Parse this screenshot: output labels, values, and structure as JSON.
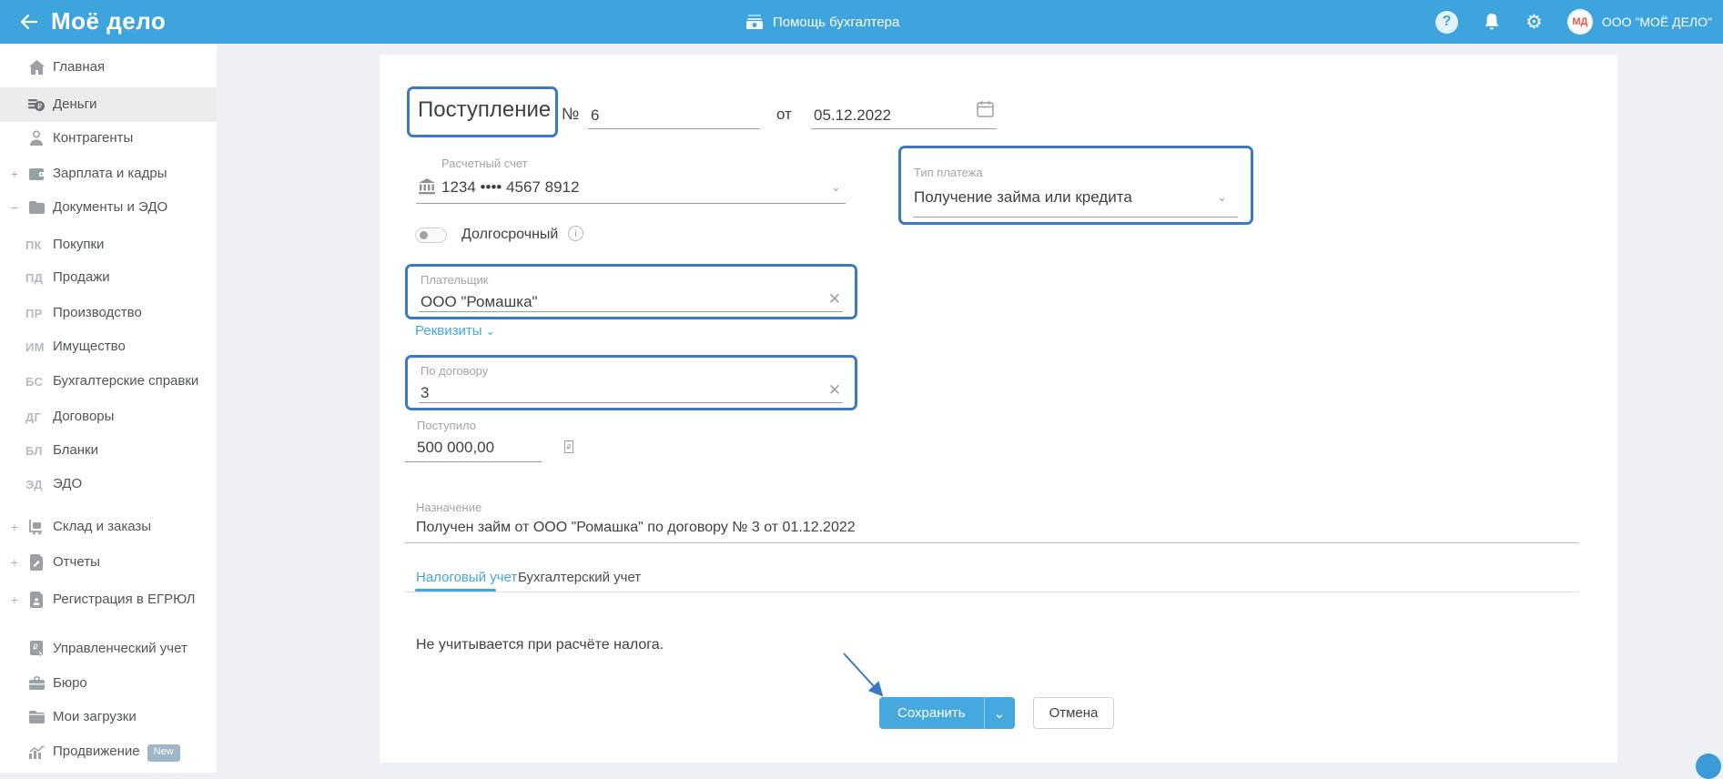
{
  "colors": {
    "header_blue": "#3da4dd",
    "annotation_blue": "#3a79c3",
    "accent_link_blue": "#44a5e0",
    "save_button_blue": "#45a9e0",
    "sidebar_active_bg": "#ebecec",
    "page_bg": "#edf0f4",
    "avatar_initials_red": "#e2574c",
    "new_badge_bg": "#9fb6c6"
  },
  "header": {
    "logo": "Моё дело",
    "back_icon": "arrow-left",
    "help_center": "Помощь бухгалтера",
    "help_center_icon": "cash-icon",
    "help_icon": "?",
    "org_name": "ООО \"МОЁ ДЕЛО\"",
    "avatar_initials": "МД",
    "gear_glyph": "⚙"
  },
  "sidebar": {
    "items": [
      {
        "label": "Главная",
        "prefix": "",
        "expand": "",
        "badge": ""
      },
      {
        "label": "Деньги",
        "prefix": "",
        "expand": "",
        "badge": "",
        "active": true
      },
      {
        "label": "Контрагенты",
        "prefix": "",
        "expand": "",
        "badge": ""
      },
      {
        "label": "Зарплата и кадры",
        "prefix": "",
        "expand": "+",
        "badge": ""
      },
      {
        "label": "Документы и ЭДО",
        "prefix": "",
        "expand": "−",
        "badge": ""
      },
      {
        "label": "Покупки",
        "prefix": "ПК",
        "expand": "",
        "badge": ""
      },
      {
        "label": "Продажи",
        "prefix": "ПД",
        "expand": "",
        "badge": ""
      },
      {
        "label": "Производство",
        "prefix": "ПР",
        "expand": "",
        "badge": ""
      },
      {
        "label": "Имущество",
        "prefix": "ИМ",
        "expand": "",
        "badge": ""
      },
      {
        "label": "Бухгалтерские справки",
        "prefix": "БС",
        "expand": "",
        "badge": ""
      },
      {
        "label": "Договоры",
        "prefix": "ДГ",
        "expand": "",
        "badge": ""
      },
      {
        "label": "Бланки",
        "prefix": "БЛ",
        "expand": "",
        "badge": ""
      },
      {
        "label": "ЭДО",
        "prefix": "ЭД",
        "expand": "",
        "badge": ""
      },
      {
        "label": "Склад и заказы",
        "prefix": "",
        "expand": "+",
        "badge": ""
      },
      {
        "label": "Отчеты",
        "prefix": "",
        "expand": "+",
        "badge": ""
      },
      {
        "label": "Регистрация в ЕГРЮЛ",
        "prefix": "",
        "expand": "+",
        "badge": ""
      },
      {
        "label": "Управленческий учет",
        "prefix": "",
        "expand": "",
        "badge": ""
      },
      {
        "label": "Бюро",
        "prefix": "",
        "expand": "",
        "badge": ""
      },
      {
        "label": "Мои загрузки",
        "prefix": "",
        "expand": "",
        "badge": ""
      },
      {
        "label": "Продвижение",
        "prefix": "",
        "expand": "",
        "badge": "New"
      }
    ]
  },
  "form": {
    "title": "Поступление",
    "number_label": "№",
    "number_value": "6",
    "date_label": "от",
    "date_value": "05.12.2022",
    "account": {
      "label": "Расчетный счет",
      "value": "1234 •••• 4567 8912"
    },
    "payment_type": {
      "label": "Тип платежа",
      "value": "Получение займа или кредита"
    },
    "long_term_label": "Долгосрочный",
    "info_glyph": "i",
    "payer": {
      "label": "Плательщик",
      "value": "ООО \"Ромашка\"",
      "clear_glyph": "✕"
    },
    "requisites_label": "Реквизиты",
    "requisites_chevron": "⌄",
    "contract": {
      "label": "По договору",
      "value": "3",
      "clear_glyph": "✕"
    },
    "received": {
      "label": "Поступило",
      "value": "500 000,00",
      "currency": "₽"
    },
    "purpose": {
      "label": "Назначение",
      "value": "Получен займ от ООО \"Ромашка\" по договору № 3 от 01.12.2022"
    },
    "tabs": [
      {
        "label": "Налоговый учет",
        "active": true
      },
      {
        "label": "Бухгалтерский учет",
        "active": false
      }
    ],
    "tax_note": "Не учитывается при расчёте налога.",
    "buttons": {
      "save": "Сохранить",
      "cancel": "Отмена"
    },
    "dropdown_chevron": "⌄"
  }
}
